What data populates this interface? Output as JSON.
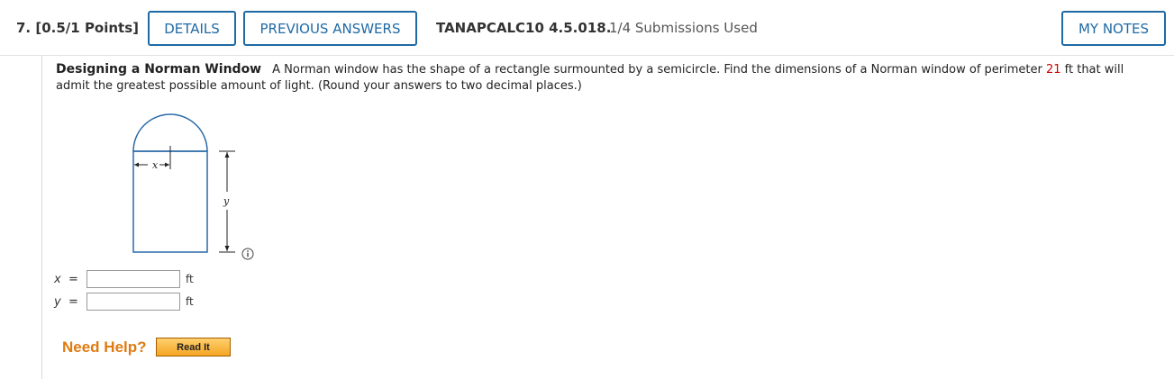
{
  "header": {
    "question_number": "7.",
    "points": "[0.5/1 Points]",
    "details_label": "DETAILS",
    "previous_answers_label": "PREVIOUS ANSWERS",
    "problem_code": "TANAPCALC10 4.5.018.",
    "submissions": "1/4 Submissions Used",
    "my_notes_label": "MY NOTES"
  },
  "problem": {
    "title": "Designing a Norman Window",
    "text_before": "A Norman window has the shape of a rectangle surmounted by a semicircle. Find the dimensions of a Norman window of perimeter ",
    "perimeter_value": "21",
    "text_after": " ft that will admit the greatest possible amount of light. (Round your answers to two decimal places.)"
  },
  "figure": {
    "x_label": "x",
    "y_label": "y",
    "info_icon": "info-icon"
  },
  "answers": [
    {
      "variable": "x",
      "equals": "=",
      "value": "",
      "unit": "ft"
    },
    {
      "variable": "y",
      "equals": "=",
      "value": "",
      "unit": "ft"
    }
  ],
  "help": {
    "need_help_label": "Need Help?",
    "read_it_label": "Read It"
  },
  "colors": {
    "accent": "#1f6aa5",
    "highlight": "#cc0000",
    "help": "#e07a12"
  }
}
